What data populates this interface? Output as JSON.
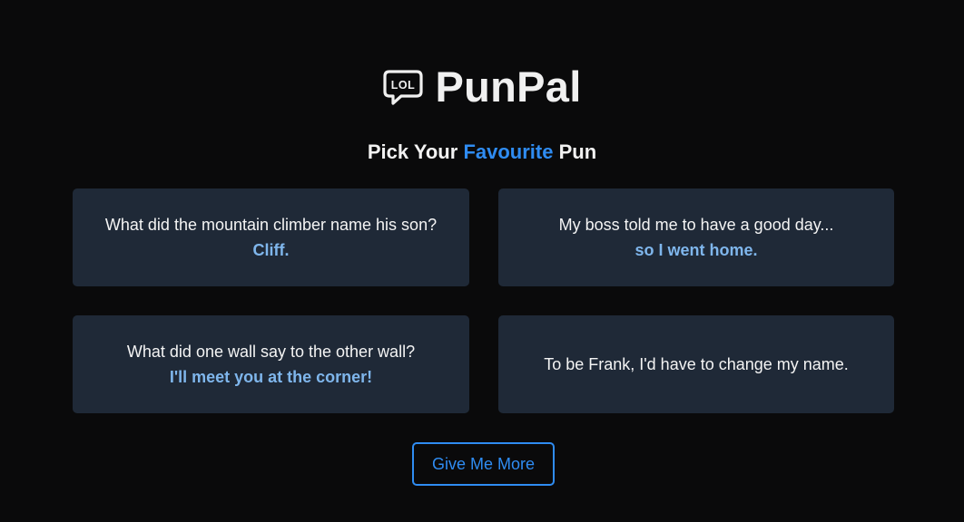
{
  "app": {
    "title": "PunPal",
    "logo_icon": "lol-speech-bubble-icon",
    "logo_text": "LOL"
  },
  "heading": {
    "prefix": "Pick Your ",
    "accent": "Favourite",
    "suffix": " Pun"
  },
  "puns": [
    {
      "setup": "What did the mountain climber name his son?",
      "punchline": "Cliff."
    },
    {
      "setup": "My boss told me to have a good day...",
      "punchline": "so I went home."
    },
    {
      "setup": "What did one wall say to the other wall?",
      "punchline": "I'll meet you at the corner!"
    },
    {
      "setup": "To be Frank, I'd have to change my name.",
      "punchline": ""
    }
  ],
  "actions": {
    "more_label": "Give Me More"
  },
  "colors": {
    "background": "#0a0a0b",
    "card": "#1f2937",
    "accent": "#2f8cf2",
    "punchline": "#7fb6ec"
  }
}
